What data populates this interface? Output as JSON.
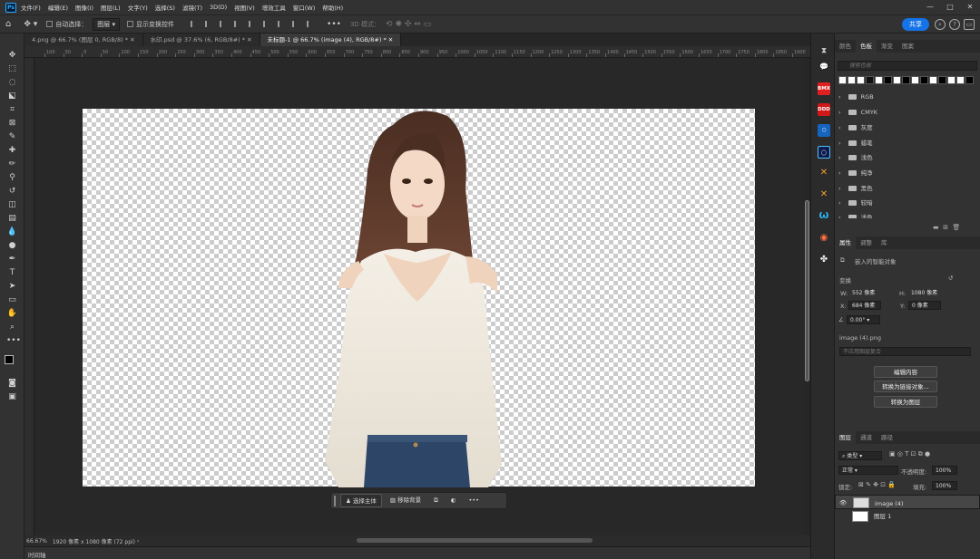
{
  "app": {
    "logo": "Ps",
    "accent": "#31a8ff",
    "share_color": "#1473e6"
  },
  "menu": [
    "文件(F)",
    "编辑(E)",
    "图像(I)",
    "图层(L)",
    "文字(Y)",
    "选择(S)",
    "滤镜(T)",
    "3D(D)",
    "视图(V)",
    "增效工具",
    "窗口(W)",
    "帮助(H)"
  ],
  "window_controls": {
    "minimize": "—",
    "maximize": "□",
    "close": "✕"
  },
  "options": {
    "auto_select_label": "自动选择：",
    "auto_select_value": "图层",
    "show_transform_label": "显示变换控件",
    "mode_3d_label": "3D 模式：",
    "share_label": "共享"
  },
  "tabs": [
    {
      "label": "4.png @ 66.7% (图层 0, RGB/8) *",
      "active": false
    },
    {
      "label": "水印.psd @ 37.6% (6, RGB/8#) *",
      "active": false
    },
    {
      "label": "未标题-1 @ 66.7% (image (4), RGB/8#) *",
      "active": true
    }
  ],
  "ruler_labels": [
    "100",
    "50",
    "0",
    "50",
    "100",
    "150",
    "200",
    "250",
    "300",
    "350",
    "400",
    "450",
    "500",
    "550",
    "600",
    "650",
    "700",
    "750",
    "800",
    "850",
    "900",
    "950",
    "1000",
    "1050",
    "1100",
    "1150",
    "1200",
    "1250",
    "1300",
    "1350",
    "1400",
    "1450",
    "1500",
    "1550",
    "1600",
    "1650",
    "1700",
    "1750",
    "1800",
    "1850",
    "1900",
    "1950",
    "2000"
  ],
  "taskbar": {
    "select_subject": "选择主体",
    "remove_bg": "移除背景"
  },
  "status": {
    "zoom": "66.67%",
    "doc_info": "1920 像素 x 1080 像素 (72 ppi)"
  },
  "timeline_label": "时间轴",
  "swatches_panel": {
    "tabs": [
      "颜色",
      "色板",
      "渐变",
      "图案"
    ],
    "active_tab": "色板",
    "search_placeholder": "搜索色板",
    "swatches": [
      "#ffffff",
      "#ffffff",
      "#ffffff",
      "#111111",
      "#ffffff",
      "#000000",
      "#ffffff",
      "#000000",
      "#ffffff",
      "#000000",
      "#ffffff",
      "#000000",
      "#ffffff",
      "#ffffff",
      "#000000"
    ],
    "groups": [
      "RGB",
      "CMYK",
      "灰度",
      "蜡笔",
      "浅色",
      "纯净",
      "黑色",
      "较暗",
      "浅色"
    ]
  },
  "properties_panel": {
    "tabs": [
      "属性",
      "调整",
      "库"
    ],
    "active_tab": "属性",
    "object_type": "嵌入的智能对象",
    "section": "变换",
    "w_label": "W:",
    "w_value": "552 像素",
    "h_label": "H:",
    "h_value": "1080 像素",
    "x_label": "X:",
    "x_value": "684 像素",
    "y_label": "Y:",
    "y_value": "0 像素",
    "angle": "0.00°",
    "filename": "image (4).png",
    "comp_placeholder": "不应用图层复合",
    "btn_edit": "编辑内容",
    "btn_linked": "转换为链接对象...",
    "btn_layers": "转换为图层"
  },
  "layers_panel": {
    "tabs": [
      "图层",
      "通道",
      "路径"
    ],
    "active_tab": "图层",
    "filter_label": "类型",
    "blend_mode": "正常",
    "opacity_label": "不透明度:",
    "opacity_value": "100%",
    "lock_label": "锁定:",
    "fill_label": "填充:",
    "fill_value": "100%",
    "layers": [
      {
        "name": "image (4)",
        "selected": true
      },
      {
        "name": "图层 1",
        "selected": false
      }
    ]
  },
  "side_strip_icons": [
    {
      "label": "BMX",
      "color": "#e02020"
    },
    {
      "label": "DDD",
      "color": "#d01818"
    }
  ]
}
